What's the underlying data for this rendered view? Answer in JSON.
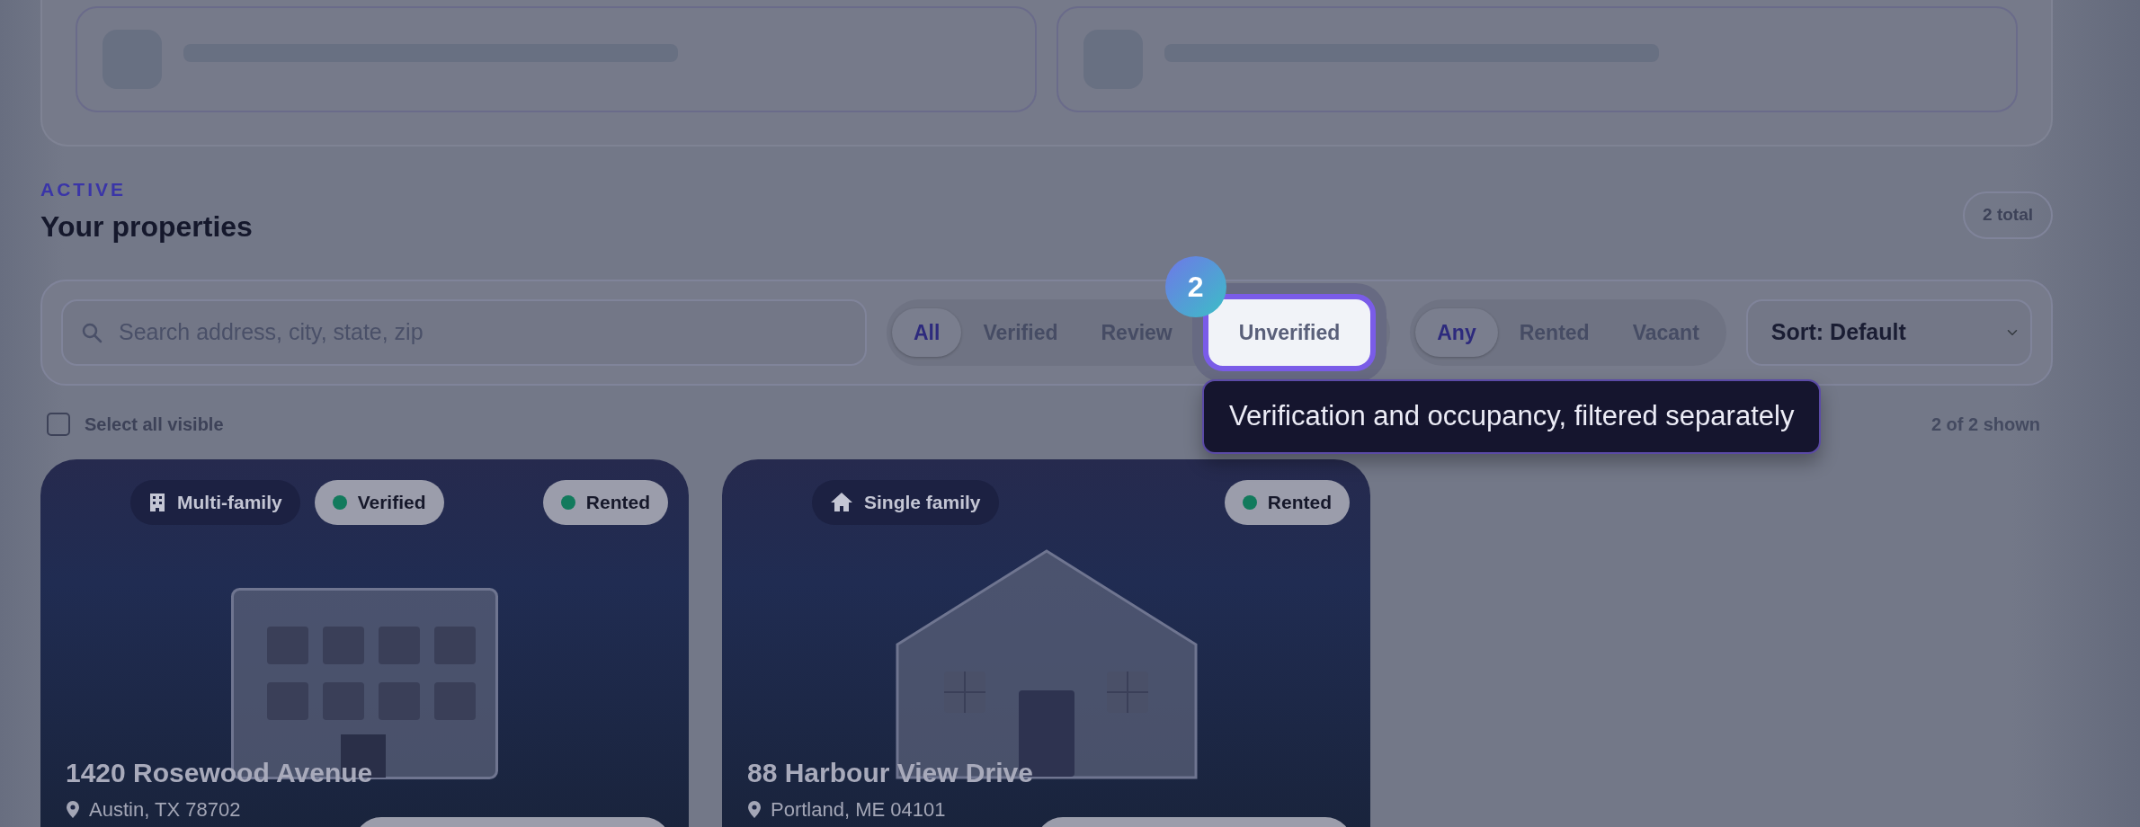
{
  "section": {
    "eyebrow": "ACTIVE",
    "title": "Your properties",
    "count": "2 total"
  },
  "filters": {
    "search": {
      "placeholder": "Search address, city, state, zip"
    },
    "verification": [
      {
        "label": "All",
        "selected": true,
        "highlighted": false
      },
      {
        "label": "Verified",
        "selected": false,
        "highlighted": false
      },
      {
        "label": "Review",
        "selected": false,
        "highlighted": false
      },
      {
        "label": "Unverified",
        "selected": false,
        "highlighted": true
      }
    ],
    "occupancy": [
      {
        "label": "Any",
        "selected": true
      },
      {
        "label": "Rented",
        "selected": false
      },
      {
        "label": "Vacant",
        "selected": false
      }
    ],
    "sort": {
      "value": "Sort: Default"
    }
  },
  "select_all": {
    "label": "Select all visible",
    "checked": false
  },
  "shown": "2 of 2 shown",
  "tour": {
    "step": "2",
    "tooltip": "Verification and occupancy, filtered separately"
  },
  "properties": [
    {
      "kind": "multi-family",
      "type_label": "Multi-family",
      "verification": "Verified",
      "occupancy": "Rented",
      "address": "1420 Rosewood Avenue",
      "location": "Austin, TX 78702"
    },
    {
      "kind": "single-family",
      "type_label": "Single family",
      "occupancy": "Rented",
      "address": "88 Harbour View Drive",
      "location": "Portland, ME 04101"
    }
  ]
}
